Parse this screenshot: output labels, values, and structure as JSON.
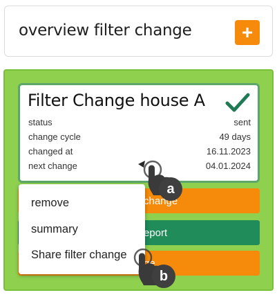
{
  "header": {
    "title": "overview filter change",
    "add_label": "+"
  },
  "card": {
    "title": "Filter Change house A",
    "rows": [
      {
        "label": "status",
        "value": "sent"
      },
      {
        "label": "change cycle",
        "value": "49 days"
      },
      {
        "label": "changed at",
        "value": "16.11.2023"
      },
      {
        "label": "next change",
        "value": "04.01.2024"
      }
    ]
  },
  "actions": [
    {
      "label": "change"
    },
    {
      "label": "eport"
    },
    {
      "label": "ge"
    }
  ],
  "menu": {
    "items": [
      "remove",
      "summary",
      "Share filter change"
    ]
  },
  "gestures": [
    "a",
    "b"
  ],
  "colors": {
    "accent_orange": "#f68b0b",
    "panel_green": "#8fd14f",
    "card_border": "#5aa66b",
    "report_green": "#1f8c5a",
    "check_green": "#1f7a55"
  }
}
